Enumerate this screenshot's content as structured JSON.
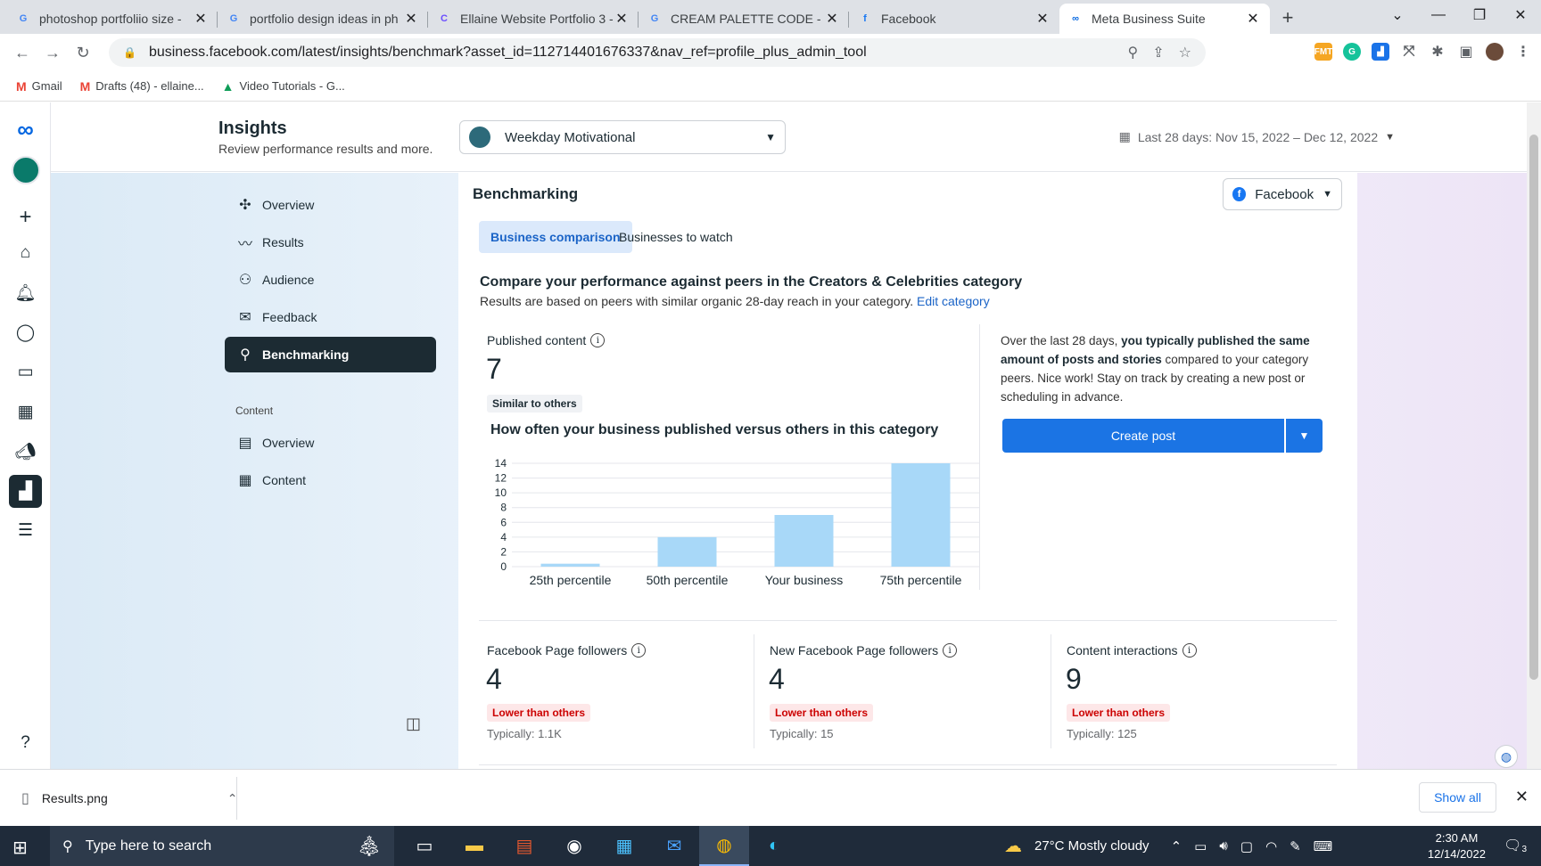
{
  "browser": {
    "tabs": [
      {
        "title": "photoshop portfoliio size -",
        "favicon": "G",
        "color": "#4285f4"
      },
      {
        "title": "portfolio design ideas in ph",
        "favicon": "G",
        "color": "#4285f4"
      },
      {
        "title": "Ellaine Website Portfolio 3 -",
        "favicon": "C",
        "color": "#6a4cff"
      },
      {
        "title": "CREAM PALETTE CODE - Go",
        "favicon": "G",
        "color": "#4285f4"
      },
      {
        "title": "Facebook",
        "favicon": "f",
        "color": "#1877f2"
      },
      {
        "title": "Meta Business Suite",
        "favicon": "∞",
        "color": "#0668e1"
      }
    ],
    "url": "business.facebook.com/latest/insights/benchmark?asset_id=112714401676337&nav_ref=profile_plus_admin_tool",
    "bookmarks": [
      {
        "label": "Gmail",
        "icon": "M"
      },
      {
        "label": "Drafts (48) - ellaine...",
        "icon": "M"
      },
      {
        "label": "Video Tutorials - G...",
        "icon": "▲"
      }
    ]
  },
  "header": {
    "title": "Insights",
    "subtitle": "Review performance results and more.",
    "asset": "Weekday Motivational",
    "date_range": "Last 28 days: Nov 15, 2022 – Dec 12, 2022"
  },
  "sidenav": {
    "items": [
      {
        "label": "Overview",
        "icon": "✣"
      },
      {
        "label": "Results",
        "icon": "〰"
      },
      {
        "label": "Audience",
        "icon": "⚇"
      },
      {
        "label": "Feedback",
        "icon": "✉"
      },
      {
        "label": "Benchmarking",
        "icon": "⚲"
      }
    ],
    "content_section": "Content",
    "content_items": [
      {
        "label": "Overview",
        "icon": "▤"
      },
      {
        "label": "Content",
        "icon": "▦"
      }
    ]
  },
  "panel": {
    "title": "Benchmarking",
    "platform": "Facebook",
    "tabs": [
      "Business comparison",
      "Businesses to watch"
    ],
    "heading": "Compare your performance against peers in the Creators & Celebrities category",
    "description": "Results are based on peers with similar organic 28-day reach in your category.",
    "edit_link": "Edit category",
    "published": {
      "label": "Published content",
      "value": "7",
      "badge": "Similar to others",
      "chart_title": "How often your business published versus others in this category"
    },
    "tip": {
      "pre": "Over the last 28 days,",
      "bold": "you typically published the same amount of posts and stories",
      "post": "compared to your category peers. Nice work! Stay on track by creating a new post or scheduling in advance."
    },
    "create_post": "Create post",
    "metrics": [
      {
        "label": "Facebook Page followers",
        "value": "4",
        "badge": "Lower than others",
        "typical": "Typically: 1.1K"
      },
      {
        "label": "New Facebook Page followers",
        "value": "4",
        "badge": "Lower than others",
        "typical": "Typically: 15"
      },
      {
        "label": "Content interactions",
        "value": "9",
        "badge": "Lower than others",
        "typical": "Typically: 125"
      }
    ]
  },
  "chart_data": {
    "type": "bar",
    "categories": [
      "25th percentile",
      "50th percentile",
      "Your business",
      "75th percentile"
    ],
    "values": [
      0.4,
      4,
      7,
      14
    ],
    "ylim": [
      0,
      14
    ],
    "yticks": [
      0,
      2,
      4,
      6,
      8,
      10,
      12,
      14
    ],
    "grid": true,
    "bar_color": "#a8d8f8"
  },
  "downloads": {
    "file": "Results.png",
    "show_all": "Show all"
  },
  "taskbar": {
    "search_placeholder": "Type here to search",
    "weather": "27°C  Mostly cloudy",
    "time": "2:30 AM",
    "date": "12/14/2022",
    "notifications": "3"
  }
}
